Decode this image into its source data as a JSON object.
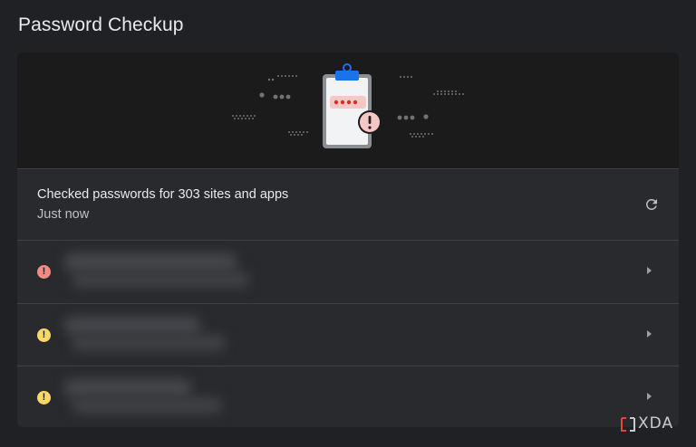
{
  "page": {
    "title": "Password Checkup"
  },
  "status": {
    "title": "Checked passwords for 303 sites and apps",
    "time": "Just now",
    "refresh_icon": "refresh-icon"
  },
  "items": [
    {
      "severity": "compromised",
      "icon": "error-circle-icon",
      "glyph": "!",
      "color": "#f28b82"
    },
    {
      "severity": "warning",
      "icon": "warning-circle-icon",
      "glyph": "!",
      "color": "#fdd663"
    },
    {
      "severity": "warning",
      "icon": "warning-circle-icon",
      "glyph": "!",
      "color": "#fdd663"
    }
  ],
  "watermark": {
    "text": "XDA"
  },
  "colors": {
    "background": "#202124",
    "card": "#292a2d",
    "banner": "#1b1b1c",
    "clipboard_clip": "#1a73e8",
    "alert_red": "#f28b82",
    "alert_yellow": "#fdd663"
  }
}
